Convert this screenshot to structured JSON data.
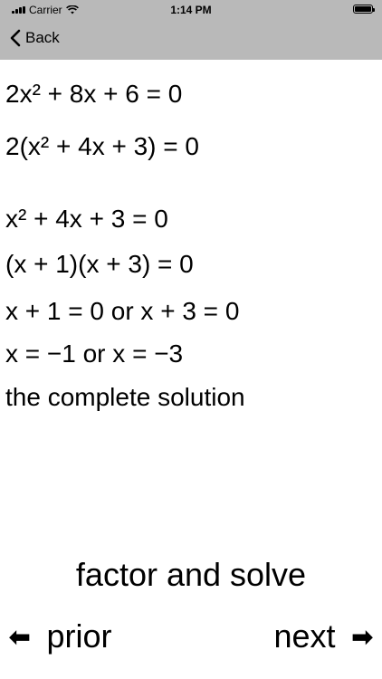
{
  "status_bar": {
    "carrier": "Carrier",
    "time": "1:14 PM"
  },
  "nav": {
    "back_label": "Back"
  },
  "steps": [
    "2x² + 8x + 6 = 0",
    "2(x² + 4x + 3) = 0",
    "x² + 4x + 3 = 0",
    "(x + 1)(x + 3) = 0",
    "x + 1 = 0 or x + 3 = 0",
    "x = −1 or x = −3",
    "the complete solution"
  ],
  "title": "factor and solve",
  "footer": {
    "prior_label": "prior",
    "next_label": "next",
    "prior_arrow": "⬅",
    "next_arrow": "➡"
  }
}
